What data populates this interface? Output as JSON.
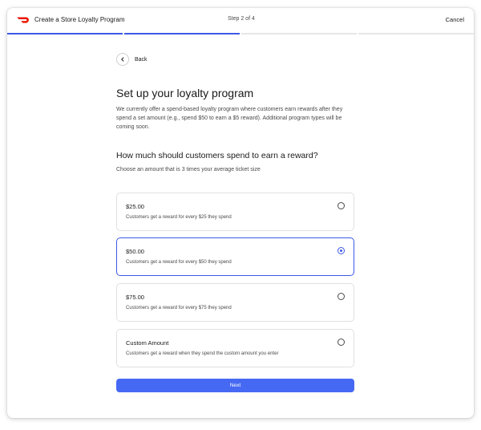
{
  "header": {
    "title": "Create a Store Loyalty Program",
    "step": "Step 2 of 4",
    "cancel_label": "Cancel",
    "brand_color": "#EB1700"
  },
  "progress": {
    "total_steps": 4,
    "completed_steps": 2,
    "accent_color": "#3D59E5"
  },
  "back": {
    "label": "Back",
    "icon": "chevron-left-icon"
  },
  "main": {
    "heading": "Set up your loyalty program",
    "description": "We currently offer a spend-based loyalty program where customers earn rewards after they spend a set amount (e.g., spend $50 to earn a $5 reward). Additional program types will be coming soon.",
    "question": "How much should customers spend to earn a reward?",
    "hint": "Choose an amount that is 3 times your average ticket size"
  },
  "options": [
    {
      "title": "$25.00",
      "description": "Customers get a reward for every $25 they spend",
      "selected": false
    },
    {
      "title": "$50.00",
      "description": "Customers get a reward for every $50 they spend",
      "selected": true
    },
    {
      "title": "$75.00",
      "description": "Customers get a reward for every $75 they spend",
      "selected": false
    },
    {
      "title": "Custom Amount",
      "description": "Customers get a reward when they spend the custom amount you enter",
      "selected": false
    }
  ],
  "footer": {
    "next_label": "Next"
  }
}
